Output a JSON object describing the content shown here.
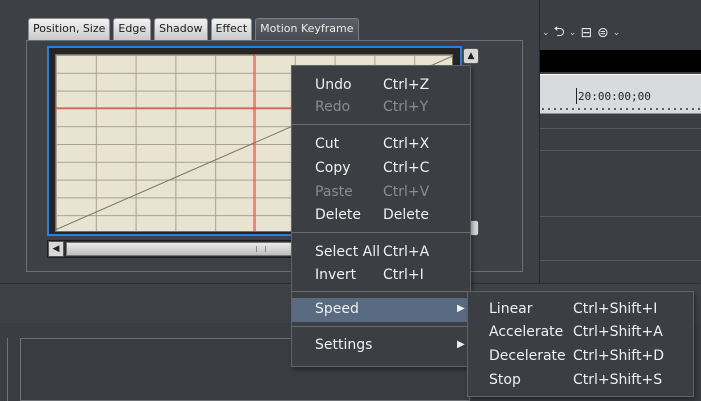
{
  "tabs": [
    "Position, Size",
    "Edge",
    "Shadow",
    "Effect",
    "Motion Keyframe"
  ],
  "active_tab": "Motion Keyframe",
  "timeline": {
    "timecode": "20:00:00;00"
  },
  "menu": {
    "items": [
      {
        "label": "Undo",
        "shortcut": "Ctrl+Z",
        "enabled": true
      },
      {
        "label": "Redo",
        "shortcut": "Ctrl+Y",
        "enabled": false
      },
      {
        "label": "Cut",
        "shortcut": "Ctrl+X",
        "enabled": true
      },
      {
        "label": "Copy",
        "shortcut": "Ctrl+C",
        "enabled": true
      },
      {
        "label": "Paste",
        "shortcut": "Ctrl+V",
        "enabled": false
      },
      {
        "label": "Delete",
        "shortcut": "Delete",
        "enabled": true
      },
      {
        "label": "Select All",
        "shortcut": "Ctrl+A",
        "enabled": true
      },
      {
        "label": "Invert",
        "shortcut": "Ctrl+I",
        "enabled": true
      },
      {
        "label": "Speed",
        "shortcut": "",
        "enabled": true,
        "submenu": true,
        "highlighted": true
      },
      {
        "label": "Settings",
        "shortcut": "",
        "enabled": true,
        "submenu": true
      }
    ]
  },
  "speed_submenu": {
    "items": [
      {
        "label": "Linear",
        "shortcut": "Ctrl+Shift+I"
      },
      {
        "label": "Accelerate",
        "shortcut": "Ctrl+Shift+A"
      },
      {
        "label": "Decelerate",
        "shortcut": "Ctrl+Shift+D"
      },
      {
        "label": "Stop",
        "shortcut": "Ctrl+Shift+S"
      }
    ]
  },
  "toolbar": {
    "icons": [
      "undo-icon",
      "redo-icon",
      "clip-icon",
      "clip-alt-icon"
    ]
  },
  "colors": {
    "highlight": "#5a6a80",
    "graph_frame": "#2c7ed6",
    "graph_bg": "#e9e4d2",
    "marker_line": "#ff2a2a"
  }
}
